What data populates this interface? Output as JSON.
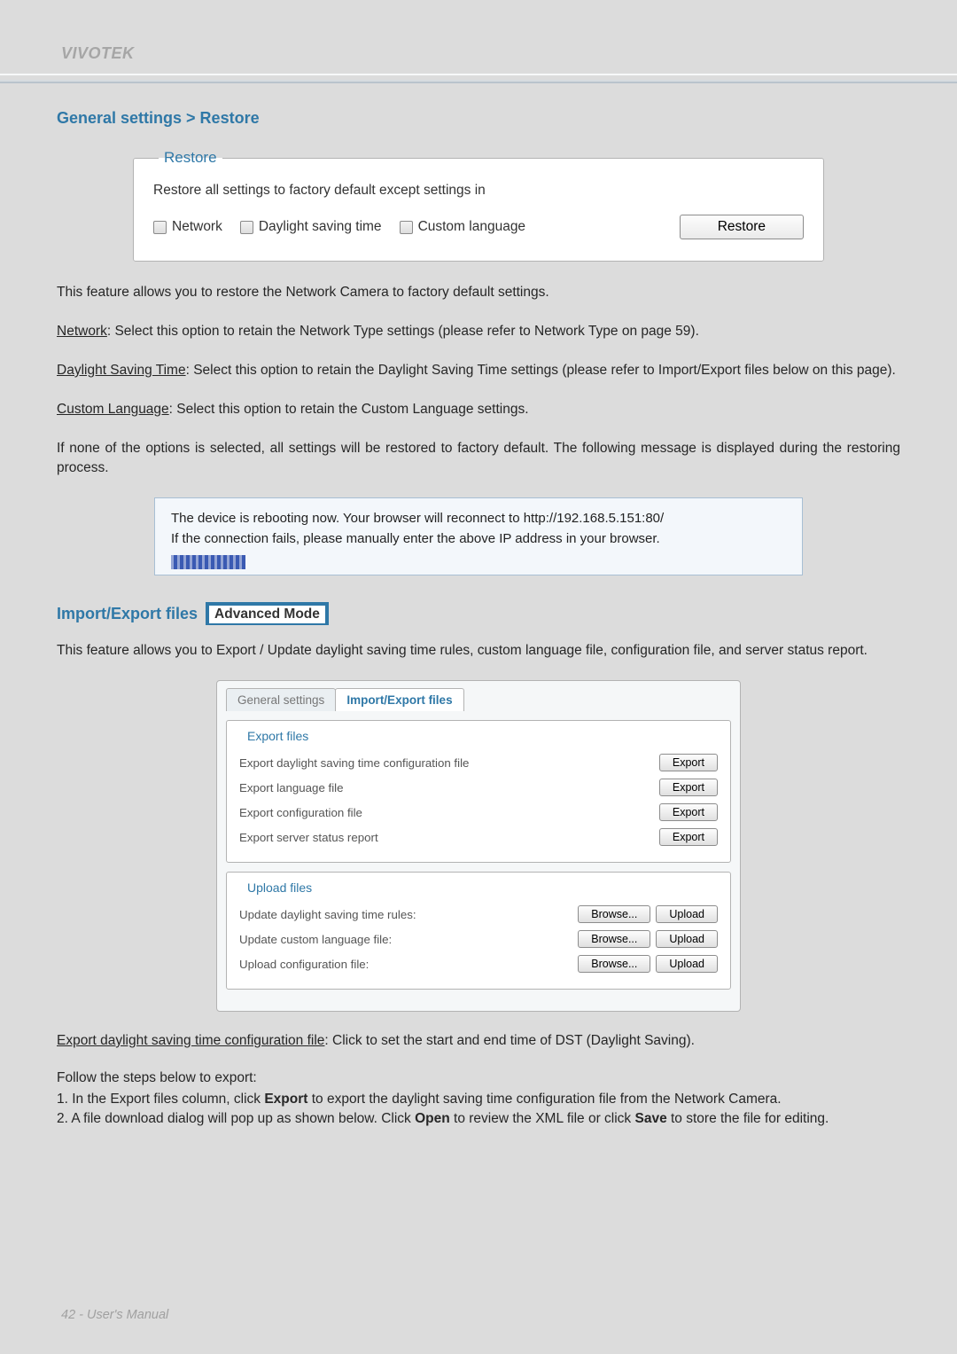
{
  "brand": "VIVOTEK",
  "section1_title": "General settings > Restore",
  "restore_box": {
    "legend": "Restore",
    "description": "Restore all settings to factory default except settings in",
    "opt_network": "Network",
    "opt_dst": "Daylight saving time",
    "opt_lang": "Custom language",
    "restore_btn": "Restore"
  },
  "para_intro": "This feature allows you to restore the Network Camera to factory default settings.",
  "para_network_label": "Network",
  "para_network_rest": ": Select this option to retain the Network Type settings (please refer to Network Type on page 59).",
  "para_dst_label": "Daylight Saving Time",
  "para_dst_rest": ": Select this option to retain the Daylight Saving Time settings (please refer to Import/Export files below on this page).",
  "para_lang_label": "Custom Language",
  "para_lang_rest": ": Select this option to retain the Custom Language settings.",
  "para_none": "If none of the options is selected, all settings will be restored to factory default.  The following message is displayed during the restoring process.",
  "reboot": {
    "line1": "The device is rebooting now. Your browser will reconnect to http://192.168.5.151:80/",
    "line2": "If the connection fails, please manually enter the above IP address in your browser."
  },
  "section2_title": "Import/Export files",
  "adv_mode": "Advanced Mode",
  "para_import_intro": "This feature allows you to Export / Update daylight saving time rules, custom language file, configuration file, and server status report.",
  "tabs": {
    "general": "General settings",
    "import": "Import/Export files"
  },
  "export_box": {
    "legend": "Export files",
    "row1": "Export daylight saving time configuration file",
    "row2": "Export language file",
    "row3": "Export configuration file",
    "row4": "Export server status report",
    "export_btn": "Export"
  },
  "upload_box": {
    "legend": "Upload files",
    "row1": "Update daylight saving time rules:",
    "row2": "Update custom language file:",
    "row3": "Upload configuration file:",
    "browse_btn": "Browse...",
    "upload_btn": "Upload"
  },
  "export_dst_label": "Export daylight saving time configuration file",
  "export_dst_rest": ": Click to set the start and end time of DST (Daylight Saving).",
  "follow_steps": "Follow the steps below to export:",
  "step1_pre": "1. In the Export files column, click ",
  "step1_bold": "Export",
  "step1_post": " to export the daylight saving time configuration file from the Network Camera.",
  "step2_pre": "2. A file download dialog will pop up as shown below. Click ",
  "step2_bold1": "Open",
  "step2_mid": " to review the XML file or click ",
  "step2_bold2": "Save",
  "step2_post": " to store the file for editing.",
  "footer_text": "42 - User's Manual"
}
